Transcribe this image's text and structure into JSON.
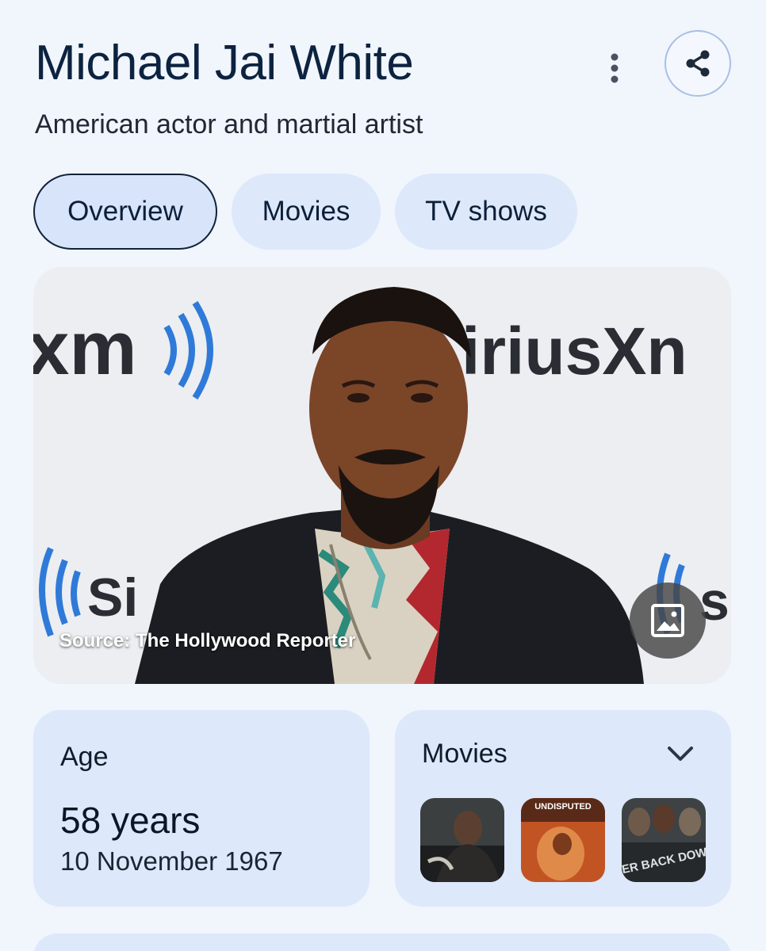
{
  "header": {
    "title": "Michael Jai White",
    "subtitle": "American actor and martial artist"
  },
  "tabs": [
    {
      "label": "Overview",
      "active": true
    },
    {
      "label": "Movies",
      "active": false
    },
    {
      "label": "TV shows",
      "active": false
    }
  ],
  "hero": {
    "source_text": "Source: The Hollywood Reporter",
    "backdrop_texts": [
      "xm",
      "iriusXn",
      "Si",
      "s"
    ]
  },
  "age_card": {
    "label": "Age",
    "value": "58 years",
    "date": "10 November 1967"
  },
  "movies_card": {
    "label": "Movies",
    "posters": [
      {
        "name": "movie-poster-1",
        "overlay": ""
      },
      {
        "name": "movie-poster-2",
        "overlay": "UNDISPUTED"
      },
      {
        "name": "movie-poster-3",
        "overlay": "NEVER BACK DOWN"
      }
    ]
  },
  "colors": {
    "background": "#f1f5fc",
    "chip": "#dde8fb",
    "card": "#dde8fb",
    "title": "#0c2340",
    "accent": "#a8c0e4"
  },
  "icons": [
    "more-vert-icon",
    "share-icon",
    "image-icon",
    "chevron-down-icon"
  ]
}
